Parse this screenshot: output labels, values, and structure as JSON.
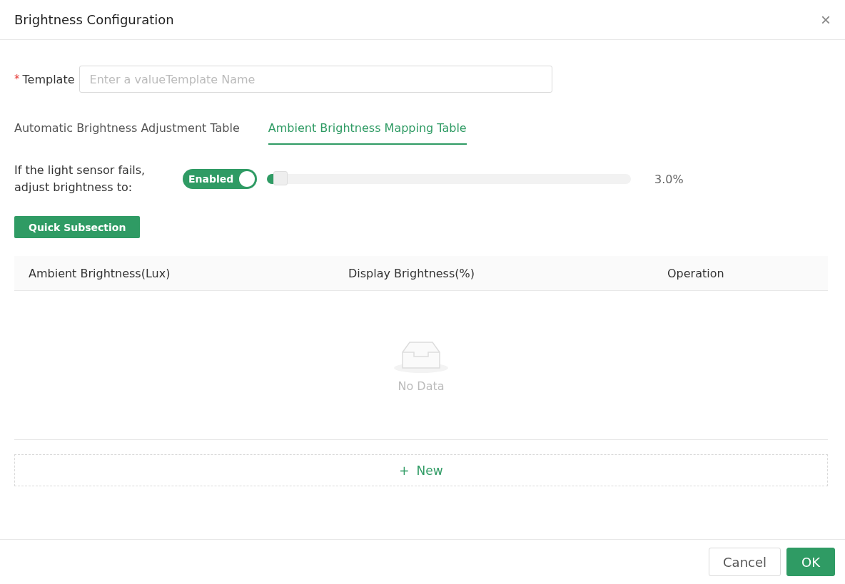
{
  "dialog": {
    "title": "Brightness Configuration",
    "close": "×"
  },
  "template": {
    "label": "Template",
    "required_mark": "*",
    "placeholder": "Enter a valueTemplate Name"
  },
  "tabs": [
    {
      "label": "Automatic Brightness Adjustment Table",
      "selected": false
    },
    {
      "label": "Ambient Brightness Mapping Table",
      "selected": true
    }
  ],
  "fallback": {
    "label": "If the light sensor fails, adjust brightness to:",
    "switch": {
      "label": "Enabled",
      "on": true
    },
    "level": 0.03,
    "reading": "3.0%"
  },
  "quick_button": "Quick Subsection",
  "table": {
    "columns": [
      "Ambient Brightness(Lux)",
      "Display Brightness(%)",
      "Operation"
    ],
    "empty": "No Data"
  },
  "new_button": {
    "icon": "+",
    "label": "New"
  },
  "buttons": [
    {
      "label": "Cancel",
      "kind": "default"
    },
    {
      "label": "OK",
      "kind": "primary"
    }
  ]
}
